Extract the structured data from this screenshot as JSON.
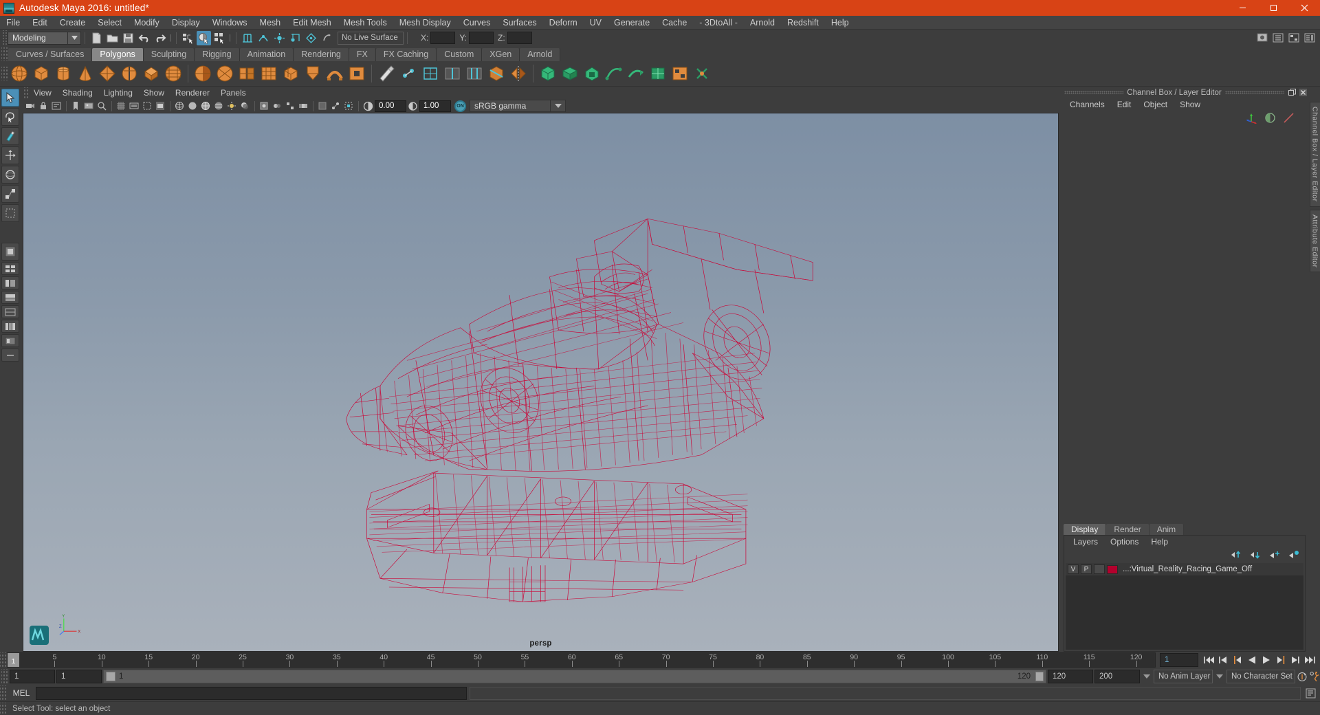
{
  "window": {
    "title": "Autodesk Maya 2016: untitled*",
    "app_icon": "maya-logo-icon",
    "minimize": "minimize-icon",
    "maximize": "maximize-icon",
    "close": "close-icon",
    "titlebar_color": "#d84315"
  },
  "menubar": {
    "items": [
      "File",
      "Edit",
      "Create",
      "Select",
      "Modify",
      "Display",
      "Windows",
      "Mesh",
      "Edit Mesh",
      "Mesh Tools",
      "Mesh Display",
      "Curves",
      "Surfaces",
      "Deform",
      "UV",
      "Generate",
      "Cache",
      "- 3DtoAll -",
      "Arnold",
      "Redshift",
      "Help"
    ]
  },
  "toolbar": {
    "mode": "Modeling",
    "live_surface": "No Live Surface",
    "coord_labels": [
      "X:",
      "Y:",
      "Z:"
    ],
    "coord_values": [
      "",
      "",
      ""
    ],
    "icons": [
      "new-scene-icon",
      "open-scene-icon",
      "save-scene-icon",
      "undo-icon",
      "redo-icon",
      "select-hierarchy-icon",
      "select-object-icon",
      "select-component-icon",
      "snap-grid-icon",
      "snap-curve-icon",
      "snap-point-icon",
      "snap-projected-icon",
      "snap-view-plane-icon",
      "make-live-icon"
    ],
    "right_icons": [
      "render-view-icon",
      "outliner-icon",
      "hypergraph-icon",
      "attribute-editor-icon"
    ]
  },
  "shelf": {
    "tabs": [
      "Curves / Surfaces",
      "Polygons",
      "Sculpting",
      "Rigging",
      "Animation",
      "Rendering",
      "FX",
      "FX Caching",
      "Custom",
      "XGen",
      "Arnold"
    ],
    "active_tab": "Polygons",
    "icons": [
      "poly-sphere-icon",
      "poly-cube-icon",
      "poly-cylinder-icon",
      "poly-cone-icon",
      "poly-torus-icon",
      "poly-plane-icon",
      "poly-disc-icon",
      "poly-platonic-icon",
      "poly-pyramid-icon",
      "poly-prism-icon",
      "poly-pipe-icon",
      "poly-helix-icon",
      "poly-soccer-ball-icon",
      "poly-super-ellipse-icon",
      "combine-icon",
      "separate-icon",
      "booleans-icon",
      "smooth-icon",
      "extrude-icon",
      "bevel-icon",
      "bridge-icon",
      "fill-hole-icon",
      "multi-cut-icon",
      "target-weld-icon",
      "quad-draw-icon",
      "insert-edge-loop-icon",
      "offset-edge-loop-icon",
      "connect-icon",
      "mirror-icon",
      "crease-icon",
      "uv-editor-icon",
      "sculpt-icon"
    ]
  },
  "toolbox": {
    "items": [
      "select-tool",
      "lasso-select-tool",
      "paint-select-tool",
      "move-tool",
      "rotate-tool",
      "scale-tool",
      "last-tool",
      "single-perspective-layout",
      "four-view-layout",
      "persp-outliner-layout",
      "persp-graph-layout",
      "persp-hypershade-layout",
      "hypershade-layout",
      "persp-uv-layout",
      "blank-layout"
    ],
    "active": "select-tool"
  },
  "viewport": {
    "menus": [
      "View",
      "Shading",
      "Lighting",
      "Show",
      "Renderer",
      "Panels"
    ],
    "toolbar_icons": [
      "select-camera-icon",
      "lock-camera-icon",
      "camera-attributes-icon",
      "bookmark-icon",
      "image-plane-icon",
      "two-d-pan-zoom-icon",
      "grid-toggle-icon",
      "film-gate-icon",
      "resolution-gate-icon",
      "gate-mask-icon",
      "wireframe-icon",
      "smooth-shade-icon",
      "shaded-wireframe-icon",
      "textured-icon",
      "lighting-icon",
      "shadows-icon",
      "screen-space-ao-icon",
      "motion-blur-icon",
      "multisample-icon",
      "depth-peeling-icon",
      "xray-icon",
      "xray-joints-icon",
      "isolate-select-icon",
      "exposure-icon",
      "gamma-icon",
      "color-management-icon"
    ],
    "exposure_value": "0.00",
    "gamma_value": "1.00",
    "color_management_toggle": "ON",
    "view_transform": "sRGB gamma",
    "camera_label": "persp",
    "axis_labels": [
      "Y",
      "X",
      "Z"
    ],
    "wireframe_color": "#cc0033",
    "background_top": "#7d8fa4",
    "background_bottom": "#a9b1bb",
    "model_name": "Virtual Reality Racing Game"
  },
  "right_panel": {
    "title": "Channel Box / Layer Editor",
    "undock_icon": "undock-icon",
    "close_icon": "close-icon",
    "channel_menus": [
      "Channels",
      "Edit",
      "Object",
      "Show"
    ],
    "channel_icons": [
      "transform-channels-icon",
      "shape-channels-icon",
      "output-channels-icon"
    ],
    "vertical_tabs": [
      "Channel Box / Layer Editor",
      "Attribute Editor"
    ]
  },
  "layer_editor": {
    "tabs": [
      "Display",
      "Render",
      "Anim"
    ],
    "active_tab": "Display",
    "menus": [
      "Layers",
      "Options",
      "Help"
    ],
    "buttons": [
      "move-layer-up-icon",
      "move-layer-down-icon",
      "new-layer-icon",
      "new-layer-from-selected-icon"
    ],
    "layers": [
      {
        "visibility": "V",
        "playback": "P",
        "state": "",
        "color": "#b3002d",
        "name": "...:Virtual_Reality_Racing_Game_Off"
      }
    ]
  },
  "time_slider": {
    "current_frame": "1",
    "start_label": "1",
    "ticks": [
      5,
      10,
      15,
      20,
      25,
      30,
      35,
      40,
      45,
      50,
      55,
      60,
      65,
      70,
      75,
      80,
      85,
      90,
      95,
      100,
      105,
      110,
      115,
      120
    ],
    "range_end": "120",
    "current_frame_field": "1",
    "playback_buttons": [
      "go-to-start-icon",
      "step-back-frame-icon",
      "step-back-key-icon",
      "play-backwards-icon",
      "play-forwards-icon",
      "step-forward-key-icon",
      "step-forward-frame-icon",
      "go-to-end-icon"
    ]
  },
  "range_slider": {
    "anim_start": "1",
    "range_start": "1",
    "bar_label": "1",
    "bar_end_label": "120",
    "range_end": "120",
    "anim_end": "200",
    "anim_layer": "No Anim Layer",
    "character_set": "No Character Set",
    "auto_key_icon": "auto-keyframe-icon",
    "prefs_icon": "animation-preferences-icon"
  },
  "command_line": {
    "language": "MEL",
    "input_value": "",
    "output_value": "",
    "script_editor_icon": "script-editor-icon"
  },
  "status_bar": {
    "message": "Select Tool: select an object"
  }
}
